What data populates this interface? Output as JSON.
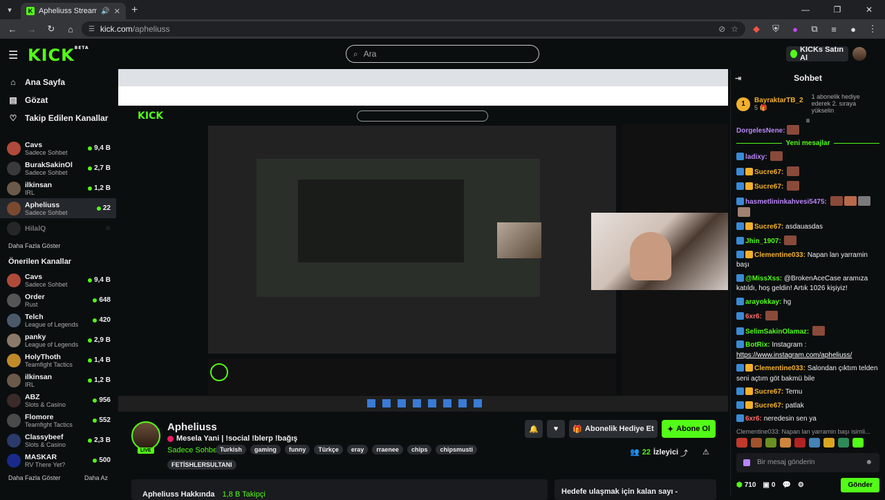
{
  "browser": {
    "tab_title": "Apheliuss Stream - Watch L",
    "url_domain": "kick.com",
    "url_path": "/apheliuss"
  },
  "header": {
    "logo": "KICK",
    "logo_beta": "BETA",
    "search_placeholder": "Ara",
    "kicks_button": "KICKs Satın Al"
  },
  "sidebar": {
    "nav": [
      {
        "label": "Ana Sayfa",
        "icon": "home-icon"
      },
      {
        "label": "Gözat",
        "icon": "browse-icon"
      },
      {
        "label": "Takip Edilen Kanallar",
        "icon": "heart-icon"
      }
    ],
    "followed": [
      {
        "name": "Cavs",
        "category": "Sadece Sohbet",
        "viewers": "9,4 B",
        "color": "#b04a3a"
      },
      {
        "name": "BurakSakinOl",
        "category": "Sadece Sohbet",
        "viewers": "2,7 B",
        "color": "#3a3a3a"
      },
      {
        "name": "ilkinsan",
        "category": "IRL",
        "viewers": "1,2 B",
        "color": "#6b5a4a"
      },
      {
        "name": "Apheliuss",
        "category": "Sadece Sohbet",
        "viewers": "22",
        "color": "#7a4a30"
      },
      {
        "name": "HilalQ",
        "category": "",
        "viewers": "",
        "color": "#444"
      }
    ],
    "show_more": "Daha Fazla Göster",
    "recommended_title": "Önerilen Kanallar",
    "recommended": [
      {
        "name": "Cavs",
        "category": "Sadece Sohbet",
        "viewers": "9,4 B",
        "color": "#b04a3a"
      },
      {
        "name": "Order",
        "category": "Rust",
        "viewers": "648",
        "color": "#555"
      },
      {
        "name": "Telch",
        "category": "League of Legends",
        "viewers": "420",
        "color": "#4a5a6a"
      },
      {
        "name": "panky",
        "category": "League of Legends",
        "viewers": "2,9 B",
        "color": "#8a7a6a"
      },
      {
        "name": "HolyThoth",
        "category": "Teamfight Tactics",
        "viewers": "1,4 B",
        "color": "#c08a2a"
      },
      {
        "name": "ilkinsan",
        "category": "IRL",
        "viewers": "1,2 B",
        "color": "#6b5a4a"
      },
      {
        "name": "ABZ",
        "category": "Slots & Casino",
        "viewers": "956",
        "color": "#3a2a2a"
      },
      {
        "name": "Flomore",
        "category": "Teamfight Tactics",
        "viewers": "552",
        "color": "#4a4a4a"
      },
      {
        "name": "Classybeef",
        "category": "Slots & Casino",
        "viewers": "2,3 B",
        "color": "#2a3a6a"
      },
      {
        "name": "MASKAR",
        "category": "RV There Yet?",
        "viewers": "500",
        "color": "#1a2a8a"
      }
    ],
    "footer_left": "Daha Fazla Göster",
    "footer_right": "Daha Az"
  },
  "stream": {
    "name": "Apheliuss",
    "title": "Mesela Yani | !social !blerp !bağış",
    "category": "Sadece Sohbet",
    "tags": [
      "Turkish",
      "gaming",
      "funny",
      "Türkçe",
      "eray",
      "rraenee",
      "chips",
      "chipsmusti"
    ],
    "tag2": "FETİSHLERSULTANI",
    "live": "LIVE",
    "gift_label": "Abonelik Hediye Et",
    "follow_label": "Abone Ol",
    "viewers_num": "22",
    "viewers_label": "İzleyici",
    "about_title": "Apheliuss Hakkında",
    "about_followers": "1,8 B Takipçi",
    "goal_title": "Hedefe ulaşmak için kalan sayı -"
  },
  "chat": {
    "title": "Sohbet",
    "pinned_name": "BayraktarTB_2",
    "pinned_count": "5",
    "pinned_rank": "1",
    "pinned_desc": "1 abonelik hediye ederek 2. sıraya yükselin",
    "first_user": "DorgelesNene:",
    "new_messages": "Yeni mesajlar",
    "messages": [
      {
        "user": "ladixy:",
        "color": "#b886f7",
        "text": ""
      },
      {
        "user": "Sucre67:",
        "color": "#f2b02c",
        "text": ""
      },
      {
        "user": "Sucre67:",
        "color": "#f2b02c",
        "text": ""
      },
      {
        "user": "hasmetlininkahvesi5475:",
        "color": "#b886f7",
        "text": ""
      },
      {
        "user": "Sucre67:",
        "color": "#f2b02c",
        "text": "asdauasdas"
      },
      {
        "user": "Jhin_1907:",
        "color": "#53fc18",
        "text": ""
      },
      {
        "user": "Clementine033:",
        "color": "#f2b02c",
        "text": "Napan lan yarramin başı"
      },
      {
        "user": "@MissXss:",
        "color": "#53fc18",
        "text": "@BrokenAceCase aramıza katıldı, hoş geldin! Artık 1026 kişiyiz!"
      },
      {
        "user": "arayokkay:",
        "color": "#53fc18",
        "text": "hg"
      },
      {
        "user": "6xr6:",
        "color": "#ff6b6b",
        "text": ""
      },
      {
        "user": "SelimSakinOlamaz:",
        "color": "#53fc18",
        "text": ""
      },
      {
        "user": "BotRix:",
        "color": "#53fc18",
        "text": "Instagram :"
      },
      {
        "user": "Clementine033:",
        "color": "#f2b02c",
        "text": "Salondan çıktım telden seni açtım göt bakmü bile"
      },
      {
        "user": "Sucre67:",
        "color": "#f2b02c",
        "text": "Temu"
      },
      {
        "user": "Sucre67:",
        "color": "#f2b02c",
        "text": "patlak"
      },
      {
        "user": "6xr6:",
        "color": "#ff6b6b",
        "text": "neredesin sen ya"
      }
    ],
    "botrix_link": "https://www.instagram.com/apheliuss/",
    "reply_hint": "Clementine033: Napan lan yarramin başı isimli...",
    "input_placeholder": "Bir mesaj gönderin",
    "points": "710",
    "count": "0",
    "send": "Gönder"
  }
}
